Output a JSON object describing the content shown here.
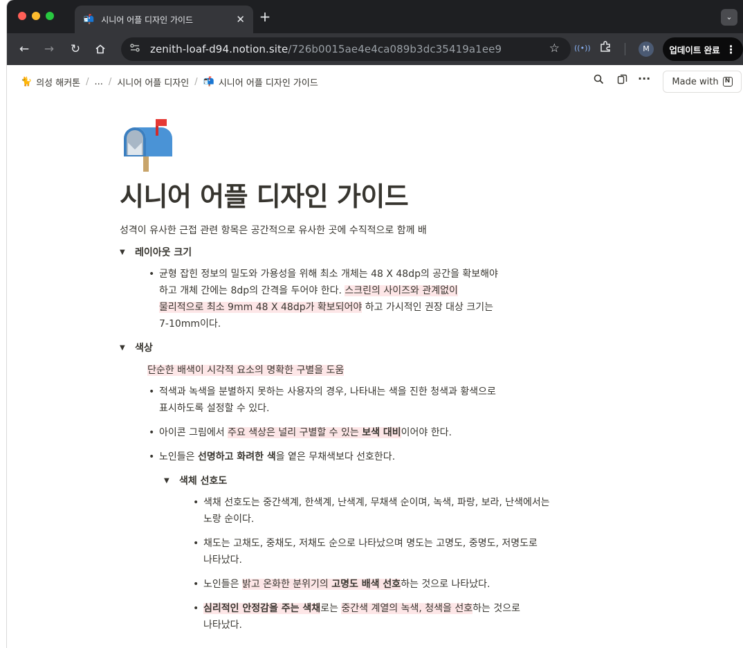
{
  "browser": {
    "tab_title": "시니어 어플 디자인 가이드",
    "tab_favicon": "📬",
    "url_host": "zenith-loaf-d94.notion.site",
    "url_path": "/726b0015ae4e4ca089b3dc35419a1ee9",
    "profile_initial": "M",
    "update_label": "업데이트 완료",
    "colors": {
      "close": "#ff5f57",
      "minimize": "#febc2e",
      "maximize": "#28c840"
    }
  },
  "notion_bar": {
    "breadcrumb": [
      {
        "icon": "🐈",
        "label": "의성 해커톤"
      },
      {
        "icon": "",
        "label": "..."
      },
      {
        "icon": "",
        "label": "시니어 어플 디자인"
      },
      {
        "icon": "📬",
        "label": "시니어 어플 디자인 가이드"
      }
    ],
    "made_with_label": "Made with"
  },
  "page": {
    "title": "시니어 어플 디자인 가이드",
    "intro": "성격이 유사한 근접 관련 항목은 공간적으로 유사한 곳에 수직적으로 함께 배",
    "sections": {
      "layout": {
        "heading": "레이아웃 크기",
        "item1_a": "균형 잡힌 정보의 밀도와 가용성을 위해 최소 개체는 48 X 48dp의 공간을 확보해야",
        "item1_b": "하고 개체 간에는 8dp의 간격을 두어야 한다. ",
        "item1_hl1": "스크린의 사이즈와 관계없이",
        "item1_hl2": "물리적으로 최소 9mm 48 X 48dp가 확보되어야",
        "item1_c": " 하고 가시적인 권장 대상 크기는",
        "item1_d": "7-10mm이다."
      },
      "color": {
        "heading": "색상",
        "callout": "단순한 배색이 시각적 요소의 명확한 구별을 도움",
        "item1_a": "적색과 녹색을 분별하지 못하는 사용자의 경우, 나타내는 색을 진한 청색과 황색으로",
        "item1_b": "표시하도록 설정할 수 있다.",
        "item2_a": "아이콘 그림에서 ",
        "item2_hl": "주요 색상은 널리 구별할 수 있는 ",
        "item2_hlb": "보색 대비",
        "item2_c": "이어야 한다.",
        "item3_a": "노인들은 ",
        "item3_b": "선명하고 화려한 색",
        "item3_c": "을 옅은 무채색보다 선호한다."
      },
      "preference": {
        "heading": "색체 선호도",
        "item1_a": "색채 선호도는 중간색계, 한색계, 난색계, 무채색 순이며, 녹색, 파랑, 보라, 난색에서는",
        "item1_b": "노랑 순이다.",
        "item2_a": "채도는 고채도, 중채도, 저채도 순으로 나타났으며 명도는 고명도, 중명도, 저명도로",
        "item2_b": "나타났다.",
        "item3_a": "노인들은 ",
        "item3_hl": "밝고 온화한 분위기의 ",
        "item3_hlb": "고명도 배색 선호",
        "item3_c": "하는 것으로 나타났다.",
        "item4_hlb": "심리적인 안정감을 주는 색채",
        "item4_b": "로는 ",
        "item4_hl": "중간색 계열의 녹색, 청색을 선호",
        "item4_c": "하는 것으로",
        "item4_d": "나타났다."
      }
    }
  }
}
